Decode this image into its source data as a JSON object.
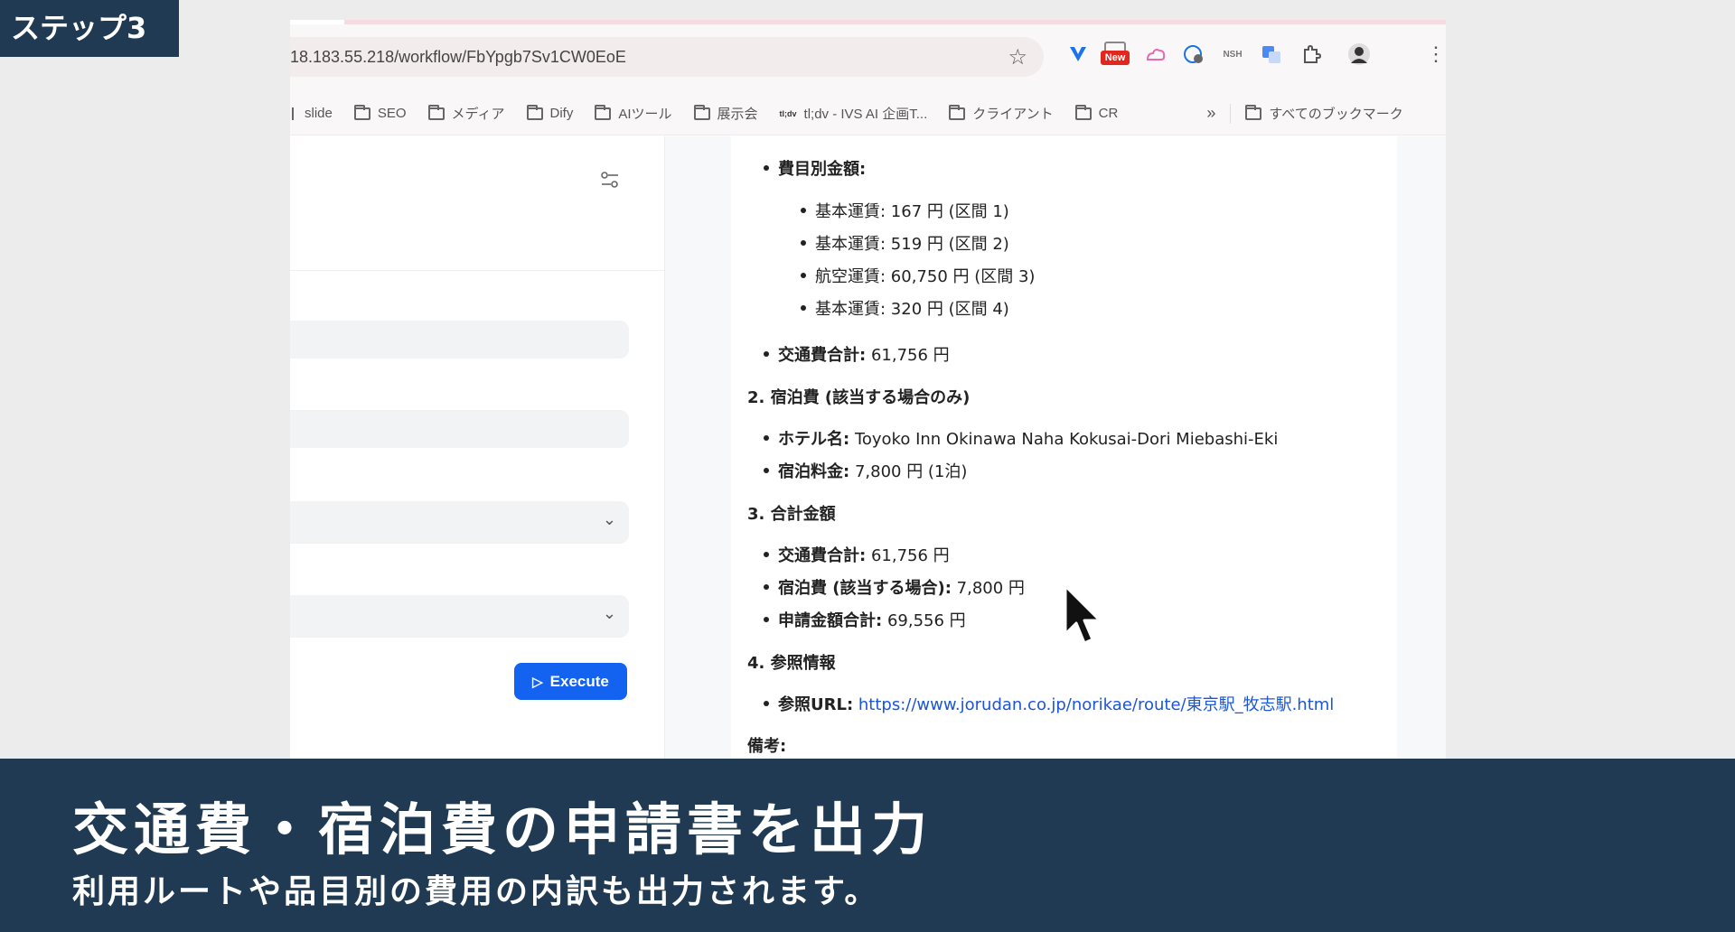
{
  "step_tag": "ステップ3",
  "browser": {
    "url": "18.183.55.218/workflow/FbYpgb7Sv1CW0EoE",
    "new_badge": "New",
    "nsh_label": "NSH",
    "bookmarks": [
      {
        "label": "slide",
        "icon": "folder-icon"
      },
      {
        "label": "SEO",
        "icon": "folder-icon"
      },
      {
        "label": "メディア",
        "icon": "folder-icon"
      },
      {
        "label": "Dify",
        "icon": "folder-icon"
      },
      {
        "label": "AIツール",
        "icon": "folder-icon"
      },
      {
        "label": "展示会",
        "icon": "folder-icon"
      },
      {
        "label": "tl;dv - IVS AI 企画T...",
        "icon": "tldv-icon"
      },
      {
        "label": "クライアント",
        "icon": "folder-icon"
      },
      {
        "label": "CR",
        "icon": "folder-icon"
      }
    ],
    "more_bookmarks": "»",
    "all_bookmarks": "すべてのブックマーク"
  },
  "left_panel": {
    "execute_label": "Execute"
  },
  "document": {
    "expense_header": "費目別金額:",
    "items": [
      "基本運賃: 167 円 (区間 1)",
      "基本運賃: 519 円 (区間 2)",
      "航空運賃: 60,750 円 (区間 3)",
      "基本運賃: 320 円 (区間 4)"
    ],
    "transport_total_label": "交通費合計:",
    "transport_total_value": "61,756 円",
    "section2_title": "2. 宿泊費 (該当する場合のみ)",
    "hotel_label": "ホテル名:",
    "hotel_value": "Toyoko Inn Okinawa Naha Kokusai-Dori Miebashi-Eki",
    "lodging_fee_label": "宿泊料金:",
    "lodging_fee_value": "7,800 円 (1泊)",
    "section3_title": "3. 合計金額",
    "sum_transport_label": "交通費合計:",
    "sum_transport_value": "61,756 円",
    "sum_lodging_label": "宿泊費 (該当する場合):",
    "sum_lodging_value": "7,800 円",
    "sum_total_label": "申請金額合計:",
    "sum_total_value": "69,556 円",
    "section4_title": "4. 参照情報",
    "ref_label": "参照URL:",
    "ref_url": "https://www.jorudan.co.jp/norikae/route/東京駅_牧志駅.html",
    "remarks_label": "備考:"
  },
  "caption": {
    "title": "交通費・宿泊費の申請書を出力",
    "subtitle": "利用ルートや品目別の費用の内訳も出力されます。"
  }
}
